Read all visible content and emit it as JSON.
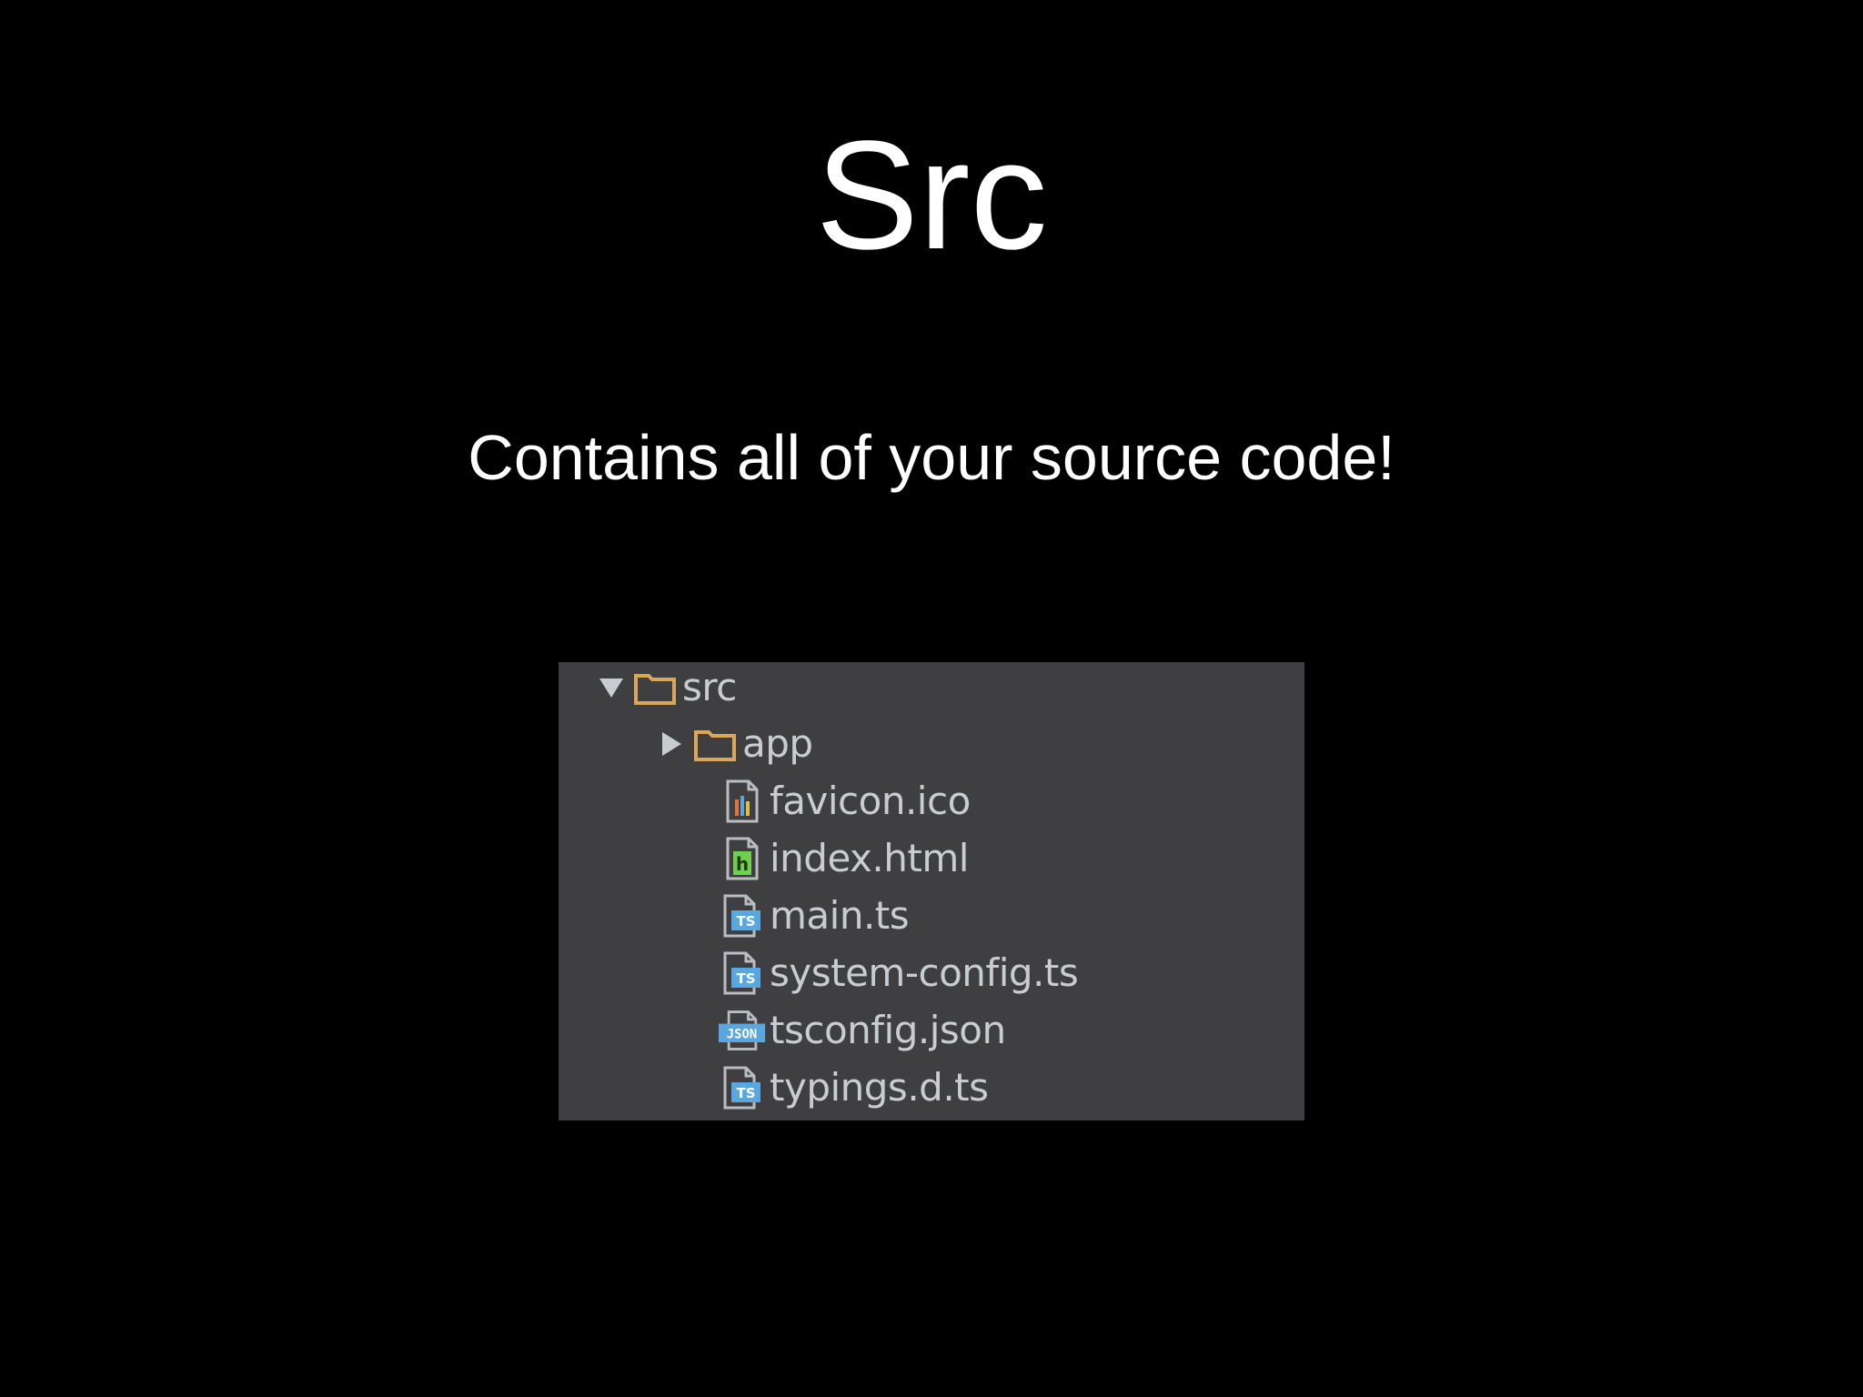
{
  "slide": {
    "title": "Src",
    "subtitle": "Contains all of your source code!"
  },
  "tree": {
    "root": {
      "label": "src",
      "expanded": true,
      "icon": "folder-icon"
    },
    "children": [
      {
        "label": "app",
        "icon": "folder-icon",
        "expandable": true,
        "expanded": false
      },
      {
        "label": "favicon.ico",
        "icon": "ico-file-icon"
      },
      {
        "label": "index.html",
        "icon": "html-file-icon"
      },
      {
        "label": "main.ts",
        "icon": "ts-file-icon"
      },
      {
        "label": "system-config.ts",
        "icon": "ts-file-icon"
      },
      {
        "label": "tsconfig.json",
        "icon": "json-file-icon"
      },
      {
        "label": "typings.d.ts",
        "icon": "ts-file-icon"
      }
    ]
  },
  "colors": {
    "background": "#000000",
    "panel": "#3f3f41",
    "folder": "#d9a75a",
    "label": "#c9cdd1",
    "ts_badge": "#5aa7e0",
    "html_badge": "#6fcf4f"
  }
}
